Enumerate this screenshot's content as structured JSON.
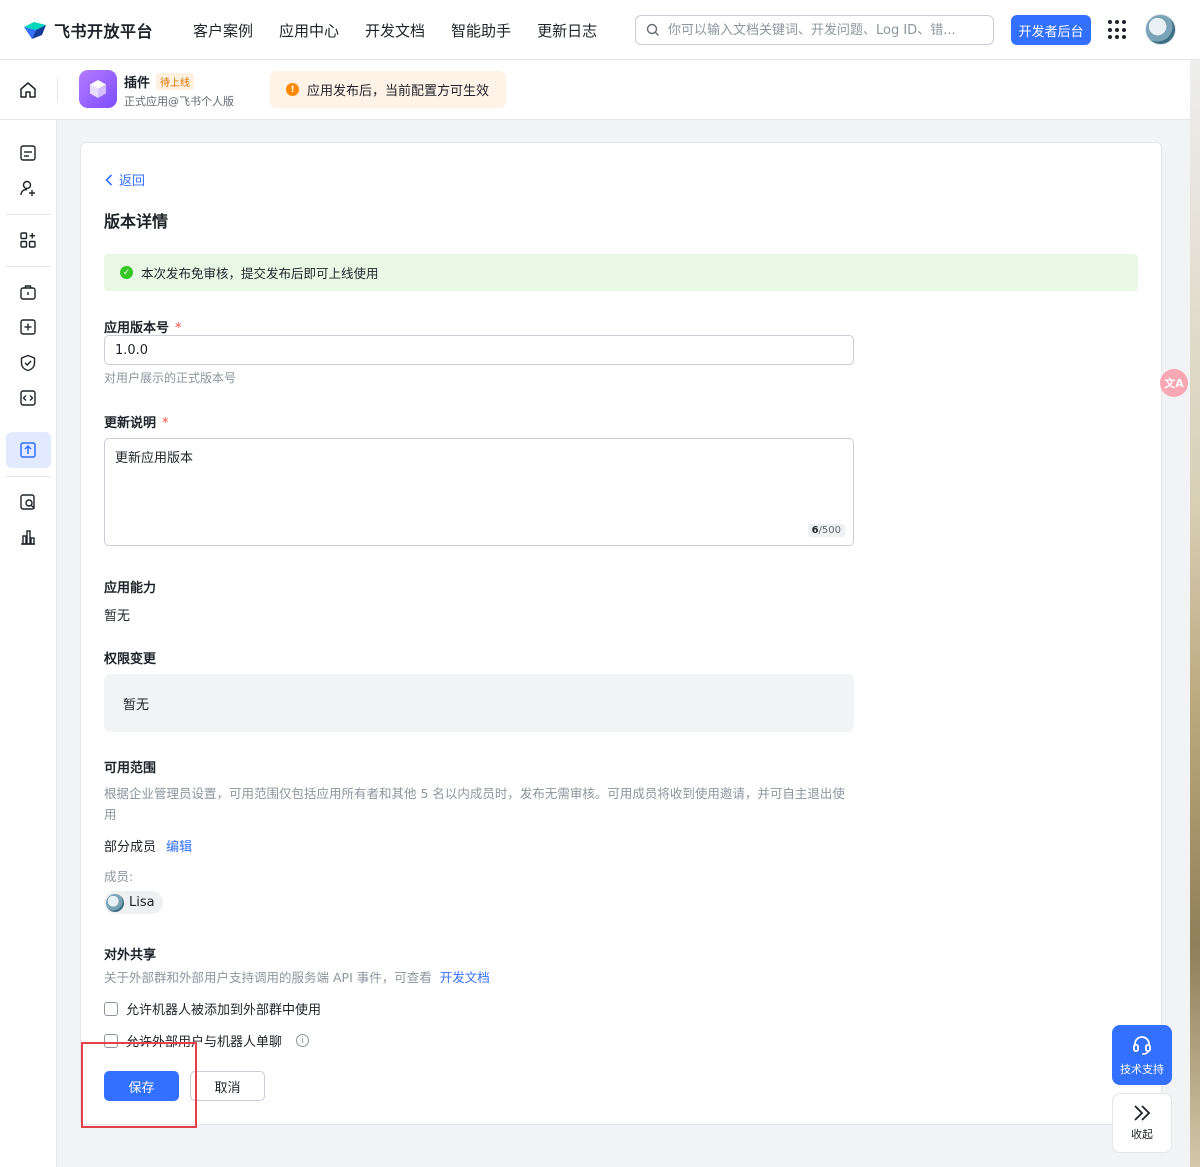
{
  "brand": {
    "name": "飞书开放平台"
  },
  "nav": [
    "客户案例",
    "应用中心",
    "开发文档",
    "智能助手",
    "更新日志"
  ],
  "search": {
    "placeholder": "你可以输入文档关键词、开发问题、Log ID、错..."
  },
  "header": {
    "dev_button": "开发者后台"
  },
  "app": {
    "name": "插件",
    "status": "待上线",
    "subtitle": "正式应用@飞书个人版"
  },
  "notice": {
    "text": "应用发布后，当前配置方可生效"
  },
  "page": {
    "back": "返回",
    "title": "版本详情",
    "success_banner": "本次发布免审核，提交发布后即可上线使用",
    "version": {
      "label": "应用版本号",
      "value": "1.0.0",
      "hint": "对用户展示的正式版本号"
    },
    "changelog": {
      "label": "更新说明",
      "value": "更新应用版本",
      "count": "6",
      "max": "/500"
    },
    "capability": {
      "label": "应用能力",
      "value": "暂无"
    },
    "permissions": {
      "label": "权限变更",
      "value": "暂无"
    },
    "scope": {
      "label": "可用范围",
      "desc": "根据企业管理员设置，可用范围仅包括应用所有者和其他 5 名以内成员时，发布无需审核。可用成员将收到使用邀请，并可自主退出使用",
      "partial": "部分成员",
      "edit": "编辑",
      "members_label": "成员:",
      "member": "Lisa"
    },
    "sharing": {
      "label": "对外共享",
      "desc": "关于外部群和外部用户支持调用的服务端 API 事件，可查看",
      "doc_link": "开发文档",
      "option1": "允许机器人被添加到外部群中使用",
      "option2": "允许外部用户与机器人单聊"
    },
    "save": "保存",
    "cancel": "取消"
  },
  "floating": {
    "support": "技术支持",
    "collapse": "收起",
    "translate": "文A"
  },
  "colors": {
    "primary": "#3370ff",
    "success_bg": "#e8f8e5",
    "warning": "#ff8800",
    "highlight": "#e4404a"
  }
}
